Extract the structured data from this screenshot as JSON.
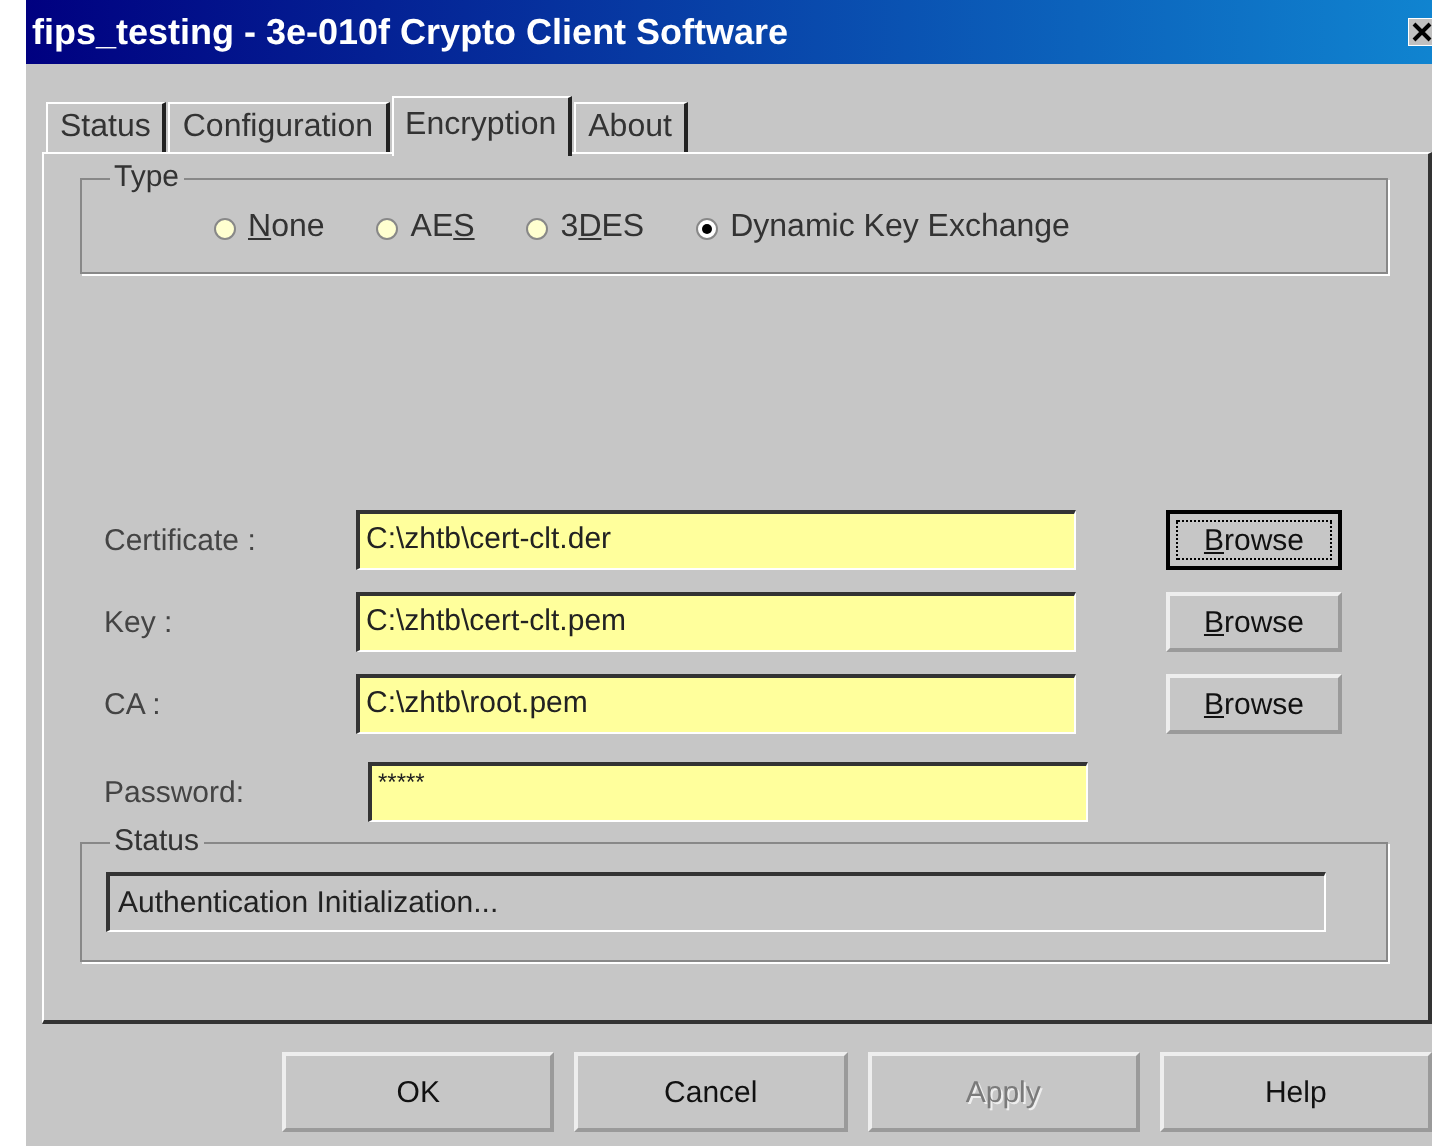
{
  "window": {
    "title": "fips_testing - 3e-010f Crypto Client Software"
  },
  "tabs": [
    {
      "label": "Status",
      "selected": false
    },
    {
      "label": "Configuration",
      "selected": false
    },
    {
      "label": "Encryption",
      "selected": true
    },
    {
      "label": "About",
      "selected": false
    }
  ],
  "type_group": {
    "title": "Type",
    "options": [
      {
        "key": "N",
        "after": "one",
        "selected": false
      },
      {
        "before": "AE",
        "key": "S",
        "selected": false
      },
      {
        "before": "3",
        "key": "D",
        "after": "ES",
        "selected": false
      },
      {
        "before": "Dynamic Key Exchange",
        "selected": true
      }
    ]
  },
  "fields": [
    {
      "label": "Certificate :",
      "value": "C:\\zhtb\\cert-clt.der",
      "browse": {
        "key": "B",
        "after": "rowse",
        "focused": true
      }
    },
    {
      "label": "Key :",
      "value": "C:\\zhtb\\cert-clt.pem",
      "browse": {
        "key": "B",
        "after": "rowse",
        "focused": false
      }
    },
    {
      "label": "CA :",
      "value": "C:\\zhtb\\root.pem",
      "browse": {
        "key": "B",
        "after": "rowse",
        "focused": false
      }
    },
    {
      "label": "Password:",
      "value": "*****"
    }
  ],
  "status_group": {
    "title": "Status",
    "message": "Authentication Initialization..."
  },
  "buttons": [
    {
      "label": "OK",
      "disabled": false
    },
    {
      "label": "Cancel",
      "disabled": false
    },
    {
      "label": "Apply",
      "disabled": true
    },
    {
      "label": "Help",
      "disabled": false
    }
  ]
}
